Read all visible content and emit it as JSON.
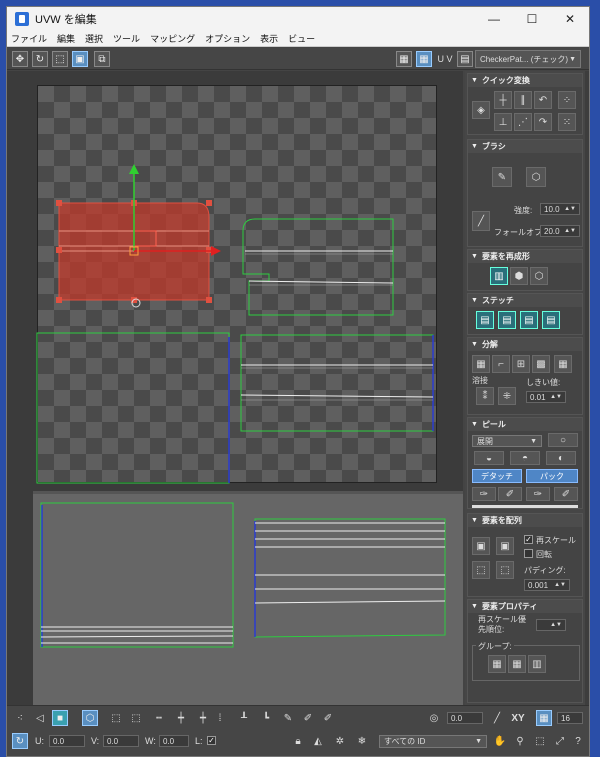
{
  "window": {
    "title": "UVW を編集",
    "minimize": "—",
    "maximize": "☐",
    "close": "✕"
  },
  "menu": [
    "ファイル",
    "編集",
    "選択",
    "ツール",
    "マッピング",
    "オプション",
    "表示",
    "ビュー"
  ],
  "toolbar": {
    "uv_label": "U V",
    "texture_dropdown": "CheckerPat... (チェック)",
    "icons": [
      "move-icon",
      "rotate-icon",
      "scale-icon",
      "freeform-icon",
      "mirror-icon"
    ]
  },
  "panel": {
    "quick_transform": {
      "title": "クイック変換"
    },
    "brush": {
      "title": "ブラシ",
      "strength_label": "強度:",
      "strength_value": "10.0",
      "falloff_label": "フォールオフ:",
      "falloff_value": "20.0"
    },
    "reshape": {
      "title": "要素を再成形"
    },
    "stitch": {
      "title": "ステッチ"
    },
    "explode": {
      "title": "分解",
      "weld_label": "溶接",
      "threshold_label": "しきい値:",
      "threshold_value": "0.01"
    },
    "peel": {
      "title": "ピール",
      "mode_value": "展開",
      "detach_label": "デタッチ",
      "pack_label": "パック"
    },
    "arrange": {
      "title": "要素を配列",
      "rescale_label": "再スケール",
      "rotate_label": "回転",
      "padding_label": "パディング:",
      "padding_value": "0.001"
    },
    "props": {
      "title": "要素プロパティ",
      "rescale_priority_label": "再スケール優\n先順位:",
      "group_label": "グループ:"
    }
  },
  "bottom": {
    "u_label": "U:",
    "u_value": "0.0",
    "v_label": "V:",
    "v_value": "0.0",
    "w_label": "W:",
    "w_value": "0.0",
    "l_label": "L:",
    "angle_value": "0.0",
    "xy_label": "XY",
    "grid_value": "16",
    "id_dropdown": "すべての ID"
  }
}
